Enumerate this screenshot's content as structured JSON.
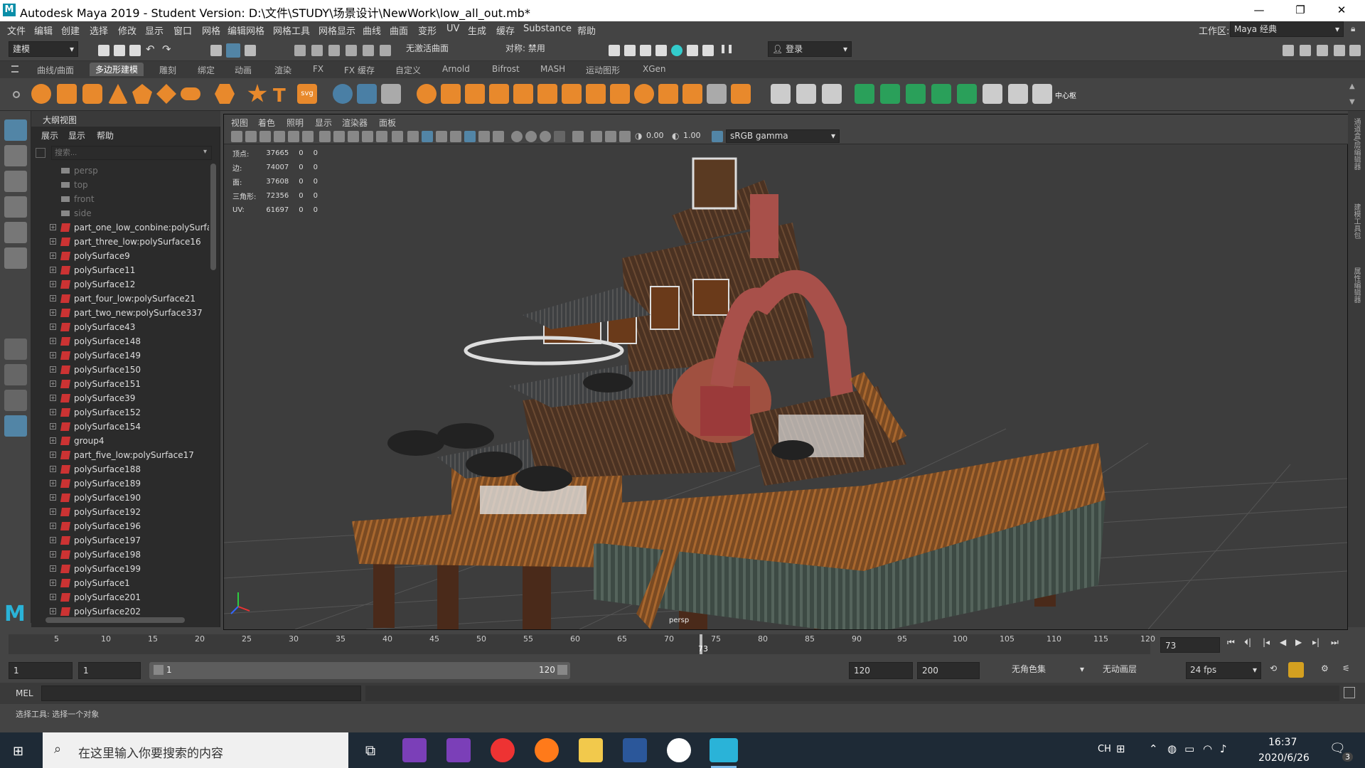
{
  "window": {
    "title": "Autodesk Maya 2019 - Student Version: D:\\文件\\STUDY\\场景设计\\NewWork\\low_all_out.mb*",
    "app_icon": "M"
  },
  "menubar": {
    "items": [
      "文件",
      "编辑",
      "创建",
      "选择",
      "修改",
      "显示",
      "窗口",
      "网格",
      "编辑网格",
      "网格工具",
      "网格显示",
      "曲线",
      "曲面",
      "变形",
      "UV",
      "生成",
      "缓存",
      "Substance",
      "帮助"
    ],
    "workspace_label": "工作区:",
    "workspace_value": "Maya 经典"
  },
  "statusline": {
    "mode": "建模",
    "live_surface": "无激活曲面",
    "symmetry": "对称: 禁用",
    "login": "登录"
  },
  "shelf_tabs": [
    "曲线/曲面",
    "多边形建模",
    "雕刻",
    "绑定",
    "动画",
    "渲染",
    "FX",
    "FX 缓存",
    "自定义",
    "Arnold",
    "Bifrost",
    "MASH",
    "运动图形",
    "XGen"
  ],
  "shelf_active": "多边形建模",
  "shelf_label": "中心枢",
  "outliner": {
    "title": "大纲视图",
    "menu": [
      "展示",
      "显示",
      "帮助"
    ],
    "search_placeholder": "搜索...",
    "cameras": [
      "persp",
      "top",
      "front",
      "side"
    ],
    "items": [
      "part_one_low_conbine:polySurfac",
      "part_three_low:polySurface16",
      "polySurface9",
      "polySurface11",
      "polySurface12",
      "part_four_low:polySurface21",
      "part_two_new:polySurface337",
      "polySurface43",
      "polySurface148",
      "polySurface149",
      "polySurface150",
      "polySurface151",
      "polySurface39",
      "polySurface152",
      "polySurface154",
      "group4",
      "part_five_low:polySurface17",
      "polySurface188",
      "polySurface189",
      "polySurface190",
      "polySurface192",
      "polySurface196",
      "polySurface197",
      "polySurface198",
      "polySurface199",
      "polySurface1",
      "polySurface201",
      "polySurface202"
    ]
  },
  "viewport": {
    "menu": [
      "视图",
      "着色",
      "照明",
      "显示",
      "渲染器",
      "面板"
    ],
    "exposure": "0.00",
    "gamma": "1.00",
    "color_space": "sRGB gamma",
    "camera_label": "persp",
    "stats": [
      {
        "label": "顶点:",
        "v": "37665",
        "a": "0",
        "b": "0"
      },
      {
        "label": "边:",
        "v": "74007",
        "a": "0",
        "b": "0"
      },
      {
        "label": "面:",
        "v": "37608",
        "a": "0",
        "b": "0"
      },
      {
        "label": "三角形:",
        "v": "72356",
        "a": "0",
        "b": "0"
      },
      {
        "label": "UV:",
        "v": "61697",
        "a": "0",
        "b": "0"
      }
    ]
  },
  "right_strip": [
    "通道盒/层编辑器",
    "建模工具包",
    "属性编辑器"
  ],
  "timeline": {
    "ticks": [
      "5",
      "10",
      "15",
      "20",
      "25",
      "30",
      "35",
      "40",
      "45",
      "50",
      "55",
      "60",
      "65",
      "70",
      "75",
      "80",
      "85",
      "90",
      "95",
      "100",
      "105",
      "110",
      "115",
      "120"
    ],
    "current_frame": "73",
    "current_frame_field": "73"
  },
  "range": {
    "start": "1",
    "start2": "1",
    "slider_start": "1",
    "slider_end": "120",
    "end": "120",
    "end2": "200",
    "char_set": "无角色集",
    "anim_layer": "无动画层",
    "fps": "24 fps"
  },
  "cmdline": {
    "label": "MEL"
  },
  "helpline": {
    "text": "选择工具: 选择一个对象"
  },
  "taskbar": {
    "search_placeholder": "在这里输入你要搜索的内容",
    "ime": "CH",
    "time": "16:37",
    "date": "2020/6/26",
    "notifications": "3"
  },
  "colors": {
    "accent": "#5285a6",
    "bg": "#444444",
    "outliner_bg": "#2b2b2b",
    "viewport_bg": "#3d3d3d"
  }
}
